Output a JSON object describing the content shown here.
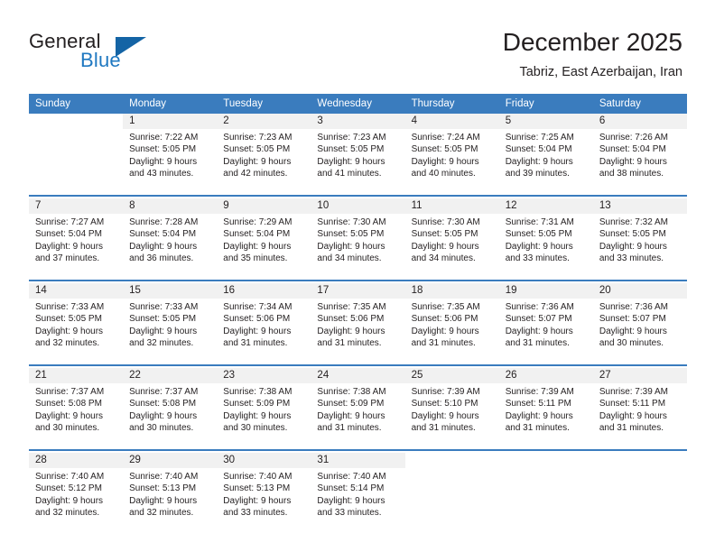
{
  "brand": {
    "name_top": "General",
    "name_bottom": "Blue",
    "triangle_color": "#1464a5",
    "blue_text_color": "#1f78c1"
  },
  "header": {
    "month_title": "December 2025",
    "location": "Tabriz, East Azerbaijan, Iran"
  },
  "theme": {
    "header_bg": "#3a7cbe",
    "header_text": "#ffffff",
    "daynum_bg": "#f1f1f1",
    "separator": "#3a7cbe",
    "text": "#231f20"
  },
  "weekday_headers": [
    "Sunday",
    "Monday",
    "Tuesday",
    "Wednesday",
    "Thursday",
    "Friday",
    "Saturday"
  ],
  "weeks": [
    [
      {
        "day": "",
        "sunrise": "",
        "sunset": "",
        "daylight_line1": "",
        "daylight_line2": ""
      },
      {
        "day": "1",
        "sunrise": "Sunrise: 7:22 AM",
        "sunset": "Sunset: 5:05 PM",
        "daylight_line1": "Daylight: 9 hours",
        "daylight_line2": "and 43 minutes."
      },
      {
        "day": "2",
        "sunrise": "Sunrise: 7:23 AM",
        "sunset": "Sunset: 5:05 PM",
        "daylight_line1": "Daylight: 9 hours",
        "daylight_line2": "and 42 minutes."
      },
      {
        "day": "3",
        "sunrise": "Sunrise: 7:23 AM",
        "sunset": "Sunset: 5:05 PM",
        "daylight_line1": "Daylight: 9 hours",
        "daylight_line2": "and 41 minutes."
      },
      {
        "day": "4",
        "sunrise": "Sunrise: 7:24 AM",
        "sunset": "Sunset: 5:05 PM",
        "daylight_line1": "Daylight: 9 hours",
        "daylight_line2": "and 40 minutes."
      },
      {
        "day": "5",
        "sunrise": "Sunrise: 7:25 AM",
        "sunset": "Sunset: 5:04 PM",
        "daylight_line1": "Daylight: 9 hours",
        "daylight_line2": "and 39 minutes."
      },
      {
        "day": "6",
        "sunrise": "Sunrise: 7:26 AM",
        "sunset": "Sunset: 5:04 PM",
        "daylight_line1": "Daylight: 9 hours",
        "daylight_line2": "and 38 minutes."
      }
    ],
    [
      {
        "day": "7",
        "sunrise": "Sunrise: 7:27 AM",
        "sunset": "Sunset: 5:04 PM",
        "daylight_line1": "Daylight: 9 hours",
        "daylight_line2": "and 37 minutes."
      },
      {
        "day": "8",
        "sunrise": "Sunrise: 7:28 AM",
        "sunset": "Sunset: 5:04 PM",
        "daylight_line1": "Daylight: 9 hours",
        "daylight_line2": "and 36 minutes."
      },
      {
        "day": "9",
        "sunrise": "Sunrise: 7:29 AM",
        "sunset": "Sunset: 5:04 PM",
        "daylight_line1": "Daylight: 9 hours",
        "daylight_line2": "and 35 minutes."
      },
      {
        "day": "10",
        "sunrise": "Sunrise: 7:30 AM",
        "sunset": "Sunset: 5:05 PM",
        "daylight_line1": "Daylight: 9 hours",
        "daylight_line2": "and 34 minutes."
      },
      {
        "day": "11",
        "sunrise": "Sunrise: 7:30 AM",
        "sunset": "Sunset: 5:05 PM",
        "daylight_line1": "Daylight: 9 hours",
        "daylight_line2": "and 34 minutes."
      },
      {
        "day": "12",
        "sunrise": "Sunrise: 7:31 AM",
        "sunset": "Sunset: 5:05 PM",
        "daylight_line1": "Daylight: 9 hours",
        "daylight_line2": "and 33 minutes."
      },
      {
        "day": "13",
        "sunrise": "Sunrise: 7:32 AM",
        "sunset": "Sunset: 5:05 PM",
        "daylight_line1": "Daylight: 9 hours",
        "daylight_line2": "and 33 minutes."
      }
    ],
    [
      {
        "day": "14",
        "sunrise": "Sunrise: 7:33 AM",
        "sunset": "Sunset: 5:05 PM",
        "daylight_line1": "Daylight: 9 hours",
        "daylight_line2": "and 32 minutes."
      },
      {
        "day": "15",
        "sunrise": "Sunrise: 7:33 AM",
        "sunset": "Sunset: 5:05 PM",
        "daylight_line1": "Daylight: 9 hours",
        "daylight_line2": "and 32 minutes."
      },
      {
        "day": "16",
        "sunrise": "Sunrise: 7:34 AM",
        "sunset": "Sunset: 5:06 PM",
        "daylight_line1": "Daylight: 9 hours",
        "daylight_line2": "and 31 minutes."
      },
      {
        "day": "17",
        "sunrise": "Sunrise: 7:35 AM",
        "sunset": "Sunset: 5:06 PM",
        "daylight_line1": "Daylight: 9 hours",
        "daylight_line2": "and 31 minutes."
      },
      {
        "day": "18",
        "sunrise": "Sunrise: 7:35 AM",
        "sunset": "Sunset: 5:06 PM",
        "daylight_line1": "Daylight: 9 hours",
        "daylight_line2": "and 31 minutes."
      },
      {
        "day": "19",
        "sunrise": "Sunrise: 7:36 AM",
        "sunset": "Sunset: 5:07 PM",
        "daylight_line1": "Daylight: 9 hours",
        "daylight_line2": "and 31 minutes."
      },
      {
        "day": "20",
        "sunrise": "Sunrise: 7:36 AM",
        "sunset": "Sunset: 5:07 PM",
        "daylight_line1": "Daylight: 9 hours",
        "daylight_line2": "and 30 minutes."
      }
    ],
    [
      {
        "day": "21",
        "sunrise": "Sunrise: 7:37 AM",
        "sunset": "Sunset: 5:08 PM",
        "daylight_line1": "Daylight: 9 hours",
        "daylight_line2": "and 30 minutes."
      },
      {
        "day": "22",
        "sunrise": "Sunrise: 7:37 AM",
        "sunset": "Sunset: 5:08 PM",
        "daylight_line1": "Daylight: 9 hours",
        "daylight_line2": "and 30 minutes."
      },
      {
        "day": "23",
        "sunrise": "Sunrise: 7:38 AM",
        "sunset": "Sunset: 5:09 PM",
        "daylight_line1": "Daylight: 9 hours",
        "daylight_line2": "and 30 minutes."
      },
      {
        "day": "24",
        "sunrise": "Sunrise: 7:38 AM",
        "sunset": "Sunset: 5:09 PM",
        "daylight_line1": "Daylight: 9 hours",
        "daylight_line2": "and 31 minutes."
      },
      {
        "day": "25",
        "sunrise": "Sunrise: 7:39 AM",
        "sunset": "Sunset: 5:10 PM",
        "daylight_line1": "Daylight: 9 hours",
        "daylight_line2": "and 31 minutes."
      },
      {
        "day": "26",
        "sunrise": "Sunrise: 7:39 AM",
        "sunset": "Sunset: 5:11 PM",
        "daylight_line1": "Daylight: 9 hours",
        "daylight_line2": "and 31 minutes."
      },
      {
        "day": "27",
        "sunrise": "Sunrise: 7:39 AM",
        "sunset": "Sunset: 5:11 PM",
        "daylight_line1": "Daylight: 9 hours",
        "daylight_line2": "and 31 minutes."
      }
    ],
    [
      {
        "day": "28",
        "sunrise": "Sunrise: 7:40 AM",
        "sunset": "Sunset: 5:12 PM",
        "daylight_line1": "Daylight: 9 hours",
        "daylight_line2": "and 32 minutes."
      },
      {
        "day": "29",
        "sunrise": "Sunrise: 7:40 AM",
        "sunset": "Sunset: 5:13 PM",
        "daylight_line1": "Daylight: 9 hours",
        "daylight_line2": "and 32 minutes."
      },
      {
        "day": "30",
        "sunrise": "Sunrise: 7:40 AM",
        "sunset": "Sunset: 5:13 PM",
        "daylight_line1": "Daylight: 9 hours",
        "daylight_line2": "and 33 minutes."
      },
      {
        "day": "31",
        "sunrise": "Sunrise: 7:40 AM",
        "sunset": "Sunset: 5:14 PM",
        "daylight_line1": "Daylight: 9 hours",
        "daylight_line2": "and 33 minutes."
      },
      {
        "day": "",
        "sunrise": "",
        "sunset": "",
        "daylight_line1": "",
        "daylight_line2": ""
      },
      {
        "day": "",
        "sunrise": "",
        "sunset": "",
        "daylight_line1": "",
        "daylight_line2": ""
      },
      {
        "day": "",
        "sunrise": "",
        "sunset": "",
        "daylight_line1": "",
        "daylight_line2": ""
      }
    ]
  ]
}
